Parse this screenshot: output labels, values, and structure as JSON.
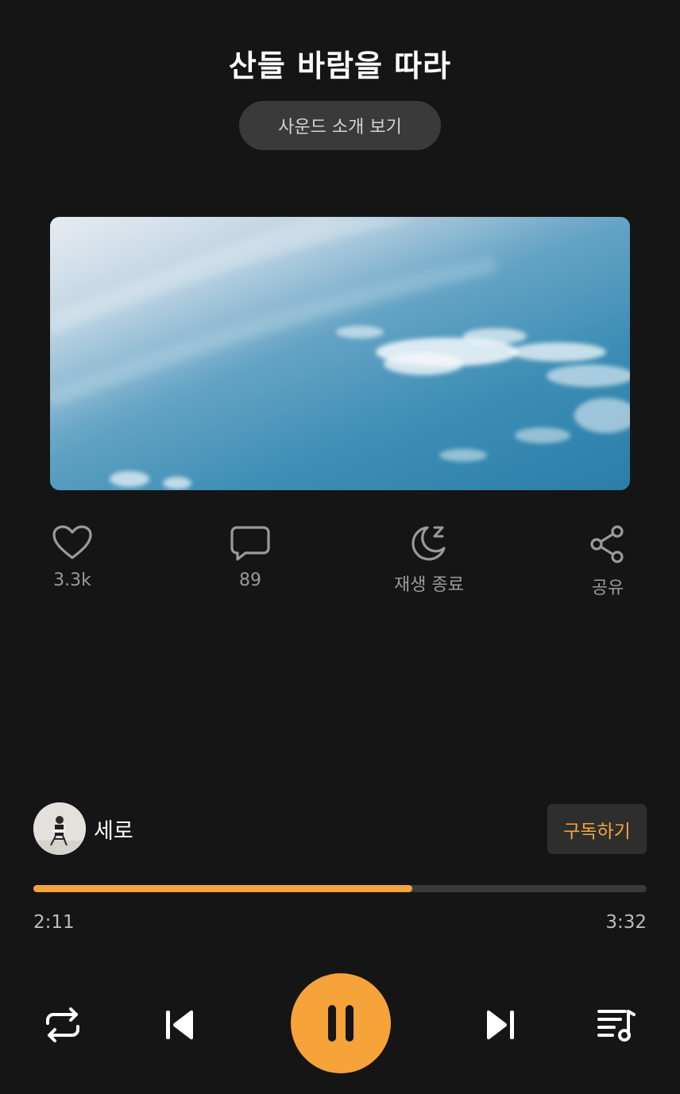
{
  "header": {
    "title": "산들 바람을 따라",
    "intro_button": "사운드 소개 보기"
  },
  "actions": [
    {
      "icon": "heart-icon",
      "label": "3.3k"
    },
    {
      "icon": "comment-icon",
      "label": "89"
    },
    {
      "icon": "sleep-timer-icon",
      "label": "재생 종료"
    },
    {
      "icon": "share-icon",
      "label": "공유"
    }
  ],
  "artist": {
    "name": "세로",
    "subscribe_label": "구독하기"
  },
  "player": {
    "elapsed": "2:11",
    "total": "3:32",
    "progress_fraction": 0.618,
    "accent_color": "#f6a33a"
  },
  "controls": {
    "repeat": "repeat-icon",
    "previous": "skip-previous-icon",
    "play_pause": "pause-icon",
    "next": "skip-next-icon",
    "playlist": "playlist-icon"
  }
}
